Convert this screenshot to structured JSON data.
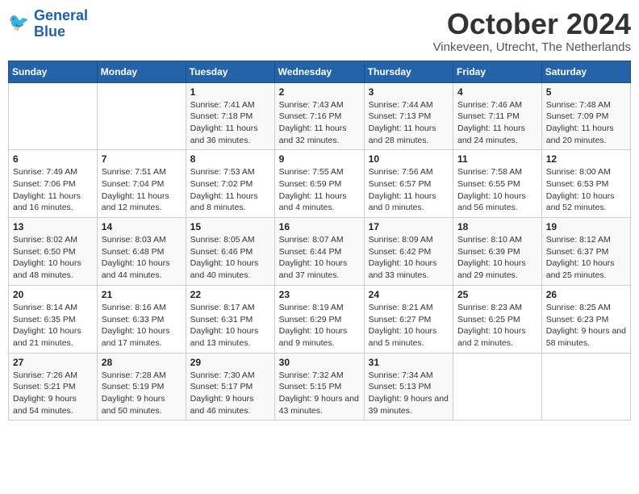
{
  "logo": {
    "line1": "General",
    "line2": "Blue"
  },
  "title": "October 2024",
  "location": "Vinkeveen, Utrecht, The Netherlands",
  "headers": [
    "Sunday",
    "Monday",
    "Tuesday",
    "Wednesday",
    "Thursday",
    "Friday",
    "Saturday"
  ],
  "weeks": [
    [
      {
        "day": "",
        "sunrise": "",
        "sunset": "",
        "daylight": ""
      },
      {
        "day": "",
        "sunrise": "",
        "sunset": "",
        "daylight": ""
      },
      {
        "day": "1",
        "sunrise": "Sunrise: 7:41 AM",
        "sunset": "Sunset: 7:18 PM",
        "daylight": "Daylight: 11 hours and 36 minutes."
      },
      {
        "day": "2",
        "sunrise": "Sunrise: 7:43 AM",
        "sunset": "Sunset: 7:16 PM",
        "daylight": "Daylight: 11 hours and 32 minutes."
      },
      {
        "day": "3",
        "sunrise": "Sunrise: 7:44 AM",
        "sunset": "Sunset: 7:13 PM",
        "daylight": "Daylight: 11 hours and 28 minutes."
      },
      {
        "day": "4",
        "sunrise": "Sunrise: 7:46 AM",
        "sunset": "Sunset: 7:11 PM",
        "daylight": "Daylight: 11 hours and 24 minutes."
      },
      {
        "day": "5",
        "sunrise": "Sunrise: 7:48 AM",
        "sunset": "Sunset: 7:09 PM",
        "daylight": "Daylight: 11 hours and 20 minutes."
      }
    ],
    [
      {
        "day": "6",
        "sunrise": "Sunrise: 7:49 AM",
        "sunset": "Sunset: 7:06 PM",
        "daylight": "Daylight: 11 hours and 16 minutes."
      },
      {
        "day": "7",
        "sunrise": "Sunrise: 7:51 AM",
        "sunset": "Sunset: 7:04 PM",
        "daylight": "Daylight: 11 hours and 12 minutes."
      },
      {
        "day": "8",
        "sunrise": "Sunrise: 7:53 AM",
        "sunset": "Sunset: 7:02 PM",
        "daylight": "Daylight: 11 hours and 8 minutes."
      },
      {
        "day": "9",
        "sunrise": "Sunrise: 7:55 AM",
        "sunset": "Sunset: 6:59 PM",
        "daylight": "Daylight: 11 hours and 4 minutes."
      },
      {
        "day": "10",
        "sunrise": "Sunrise: 7:56 AM",
        "sunset": "Sunset: 6:57 PM",
        "daylight": "Daylight: 11 hours and 0 minutes."
      },
      {
        "day": "11",
        "sunrise": "Sunrise: 7:58 AM",
        "sunset": "Sunset: 6:55 PM",
        "daylight": "Daylight: 10 hours and 56 minutes."
      },
      {
        "day": "12",
        "sunrise": "Sunrise: 8:00 AM",
        "sunset": "Sunset: 6:53 PM",
        "daylight": "Daylight: 10 hours and 52 minutes."
      }
    ],
    [
      {
        "day": "13",
        "sunrise": "Sunrise: 8:02 AM",
        "sunset": "Sunset: 6:50 PM",
        "daylight": "Daylight: 10 hours and 48 minutes."
      },
      {
        "day": "14",
        "sunrise": "Sunrise: 8:03 AM",
        "sunset": "Sunset: 6:48 PM",
        "daylight": "Daylight: 10 hours and 44 minutes."
      },
      {
        "day": "15",
        "sunrise": "Sunrise: 8:05 AM",
        "sunset": "Sunset: 6:46 PM",
        "daylight": "Daylight: 10 hours and 40 minutes."
      },
      {
        "day": "16",
        "sunrise": "Sunrise: 8:07 AM",
        "sunset": "Sunset: 6:44 PM",
        "daylight": "Daylight: 10 hours and 37 minutes."
      },
      {
        "day": "17",
        "sunrise": "Sunrise: 8:09 AM",
        "sunset": "Sunset: 6:42 PM",
        "daylight": "Daylight: 10 hours and 33 minutes."
      },
      {
        "day": "18",
        "sunrise": "Sunrise: 8:10 AM",
        "sunset": "Sunset: 6:39 PM",
        "daylight": "Daylight: 10 hours and 29 minutes."
      },
      {
        "day": "19",
        "sunrise": "Sunrise: 8:12 AM",
        "sunset": "Sunset: 6:37 PM",
        "daylight": "Daylight: 10 hours and 25 minutes."
      }
    ],
    [
      {
        "day": "20",
        "sunrise": "Sunrise: 8:14 AM",
        "sunset": "Sunset: 6:35 PM",
        "daylight": "Daylight: 10 hours and 21 minutes."
      },
      {
        "day": "21",
        "sunrise": "Sunrise: 8:16 AM",
        "sunset": "Sunset: 6:33 PM",
        "daylight": "Daylight: 10 hours and 17 minutes."
      },
      {
        "day": "22",
        "sunrise": "Sunrise: 8:17 AM",
        "sunset": "Sunset: 6:31 PM",
        "daylight": "Daylight: 10 hours and 13 minutes."
      },
      {
        "day": "23",
        "sunrise": "Sunrise: 8:19 AM",
        "sunset": "Sunset: 6:29 PM",
        "daylight": "Daylight: 10 hours and 9 minutes."
      },
      {
        "day": "24",
        "sunrise": "Sunrise: 8:21 AM",
        "sunset": "Sunset: 6:27 PM",
        "daylight": "Daylight: 10 hours and 5 minutes."
      },
      {
        "day": "25",
        "sunrise": "Sunrise: 8:23 AM",
        "sunset": "Sunset: 6:25 PM",
        "daylight": "Daylight: 10 hours and 2 minutes."
      },
      {
        "day": "26",
        "sunrise": "Sunrise: 8:25 AM",
        "sunset": "Sunset: 6:23 PM",
        "daylight": "Daylight: 9 hours and 58 minutes."
      }
    ],
    [
      {
        "day": "27",
        "sunrise": "Sunrise: 7:26 AM",
        "sunset": "Sunset: 5:21 PM",
        "daylight": "Daylight: 9 hours and 54 minutes."
      },
      {
        "day": "28",
        "sunrise": "Sunrise: 7:28 AM",
        "sunset": "Sunset: 5:19 PM",
        "daylight": "Daylight: 9 hours and 50 minutes."
      },
      {
        "day": "29",
        "sunrise": "Sunrise: 7:30 AM",
        "sunset": "Sunset: 5:17 PM",
        "daylight": "Daylight: 9 hours and 46 minutes."
      },
      {
        "day": "30",
        "sunrise": "Sunrise: 7:32 AM",
        "sunset": "Sunset: 5:15 PM",
        "daylight": "Daylight: 9 hours and 43 minutes."
      },
      {
        "day": "31",
        "sunrise": "Sunrise: 7:34 AM",
        "sunset": "Sunset: 5:13 PM",
        "daylight": "Daylight: 9 hours and 39 minutes."
      },
      {
        "day": "",
        "sunrise": "",
        "sunset": "",
        "daylight": ""
      },
      {
        "day": "",
        "sunrise": "",
        "sunset": "",
        "daylight": ""
      }
    ]
  ]
}
